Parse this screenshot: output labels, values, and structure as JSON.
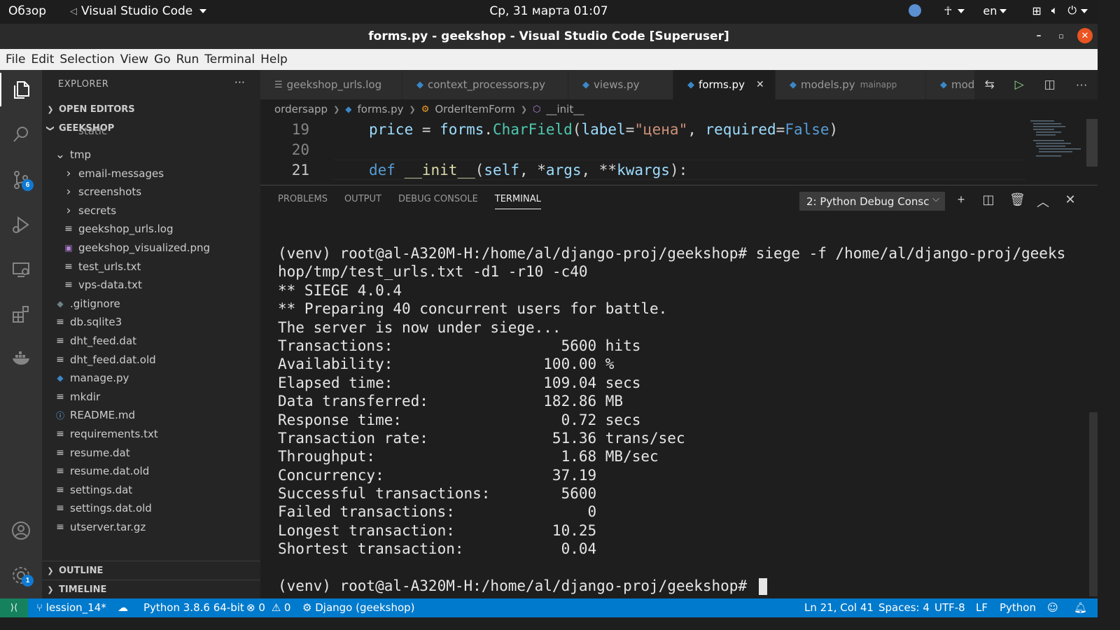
{
  "os_bar": {
    "activities": "Обзор",
    "app_name": "Visual Studio Code",
    "clock": "Ср, 31 марта  01:07",
    "lang": "en"
  },
  "window": {
    "title": "forms.py - geekshop - Visual Studio Code [Superuser]"
  },
  "menu": [
    "File",
    "Edit",
    "Selection",
    "View",
    "Go",
    "Run",
    "Terminal",
    "Help"
  ],
  "activity_bar": {
    "scm_badge": "6",
    "settings_badge": "1"
  },
  "explorer": {
    "title": "EXPLORER",
    "more": "···",
    "open_editors": "OPEN EDITORS",
    "project": "GEEKSHOP",
    "partial_top": "static",
    "items": [
      {
        "label": "tmp",
        "kind": "folder-open",
        "indent": 1
      },
      {
        "label": "email-messages",
        "kind": "folder",
        "indent": 2
      },
      {
        "label": "screenshots",
        "kind": "folder",
        "indent": 2
      },
      {
        "label": "secrets",
        "kind": "folder",
        "indent": 2
      },
      {
        "label": "geekshop_urls.log",
        "kind": "lines",
        "indent": 2
      },
      {
        "label": "geekshop_visualized.png",
        "kind": "img",
        "indent": 2
      },
      {
        "label": "test_urls.txt",
        "kind": "lines",
        "indent": 2
      },
      {
        "label": "vps-data.txt",
        "kind": "lines",
        "indent": 2
      },
      {
        "label": ".gitignore",
        "kind": "git",
        "indent": 1
      },
      {
        "label": "db.sqlite3",
        "kind": "lines",
        "indent": 1
      },
      {
        "label": "dht_feed.dat",
        "kind": "lines",
        "indent": 1
      },
      {
        "label": "dht_feed.dat.old",
        "kind": "lines",
        "indent": 1
      },
      {
        "label": "manage.py",
        "kind": "py",
        "indent": 1
      },
      {
        "label": "mkdir",
        "kind": "lines",
        "indent": 1
      },
      {
        "label": "README.md",
        "kind": "info",
        "indent": 1
      },
      {
        "label": "requirements.txt",
        "kind": "lines",
        "indent": 1
      },
      {
        "label": "resume.dat",
        "kind": "lines",
        "indent": 1
      },
      {
        "label": "resume.dat.old",
        "kind": "lines",
        "indent": 1
      },
      {
        "label": "settings.dat",
        "kind": "lines",
        "indent": 1
      },
      {
        "label": "settings.dat.old",
        "kind": "lines",
        "indent": 1
      },
      {
        "label": "utserver.tar.gz",
        "kind": "lines",
        "indent": 1
      }
    ],
    "outline": "OUTLINE",
    "timeline": "TIMELINE"
  },
  "tabs": [
    {
      "label": "geekshop_urls.log",
      "icon": "lines",
      "active": false
    },
    {
      "label": "context_processors.py",
      "icon": "py",
      "active": false
    },
    {
      "label": "views.py",
      "icon": "py",
      "active": false
    },
    {
      "label": "forms.py",
      "icon": "py",
      "active": true
    },
    {
      "label": "models.py",
      "sub": "mainapp",
      "icon": "py",
      "active": false
    },
    {
      "label": "mode",
      "icon": "py",
      "active": false
    }
  ],
  "breadcrumb": [
    "ordersapp",
    "forms.py",
    "OrderItemForm",
    "__init__"
  ],
  "editor": {
    "lines": [
      {
        "num": "19",
        "current": false
      },
      {
        "num": "20",
        "current": false
      },
      {
        "num": "21",
        "current": true
      }
    ]
  },
  "panel": {
    "tabs": [
      "PROBLEMS",
      "OUTPUT",
      "DEBUG CONSOLE",
      "TERMINAL"
    ],
    "active_tab": "TERMINAL",
    "terminal_select": "2: Python Debug Consc"
  },
  "terminal": {
    "lines": [
      "(venv) root@al-A320M-H:/home/al/django-proj/geekshop# siege -f /home/al/django-proj/geeks",
      "hop/tmp/test_urls.txt -d1 -r10 -c40",
      "** SIEGE 4.0.4",
      "** Preparing 40 concurrent users for battle.",
      "The server is now under siege...",
      "Transactions:                   5600 hits",
      "Availability:                 100.00 %",
      "Elapsed time:                 109.04 secs",
      "Data transferred:             182.86 MB",
      "Response time:                  0.72 secs",
      "Transaction rate:              51.36 trans/sec",
      "Throughput:                     1.68 MB/sec",
      "Concurrency:                   37.19",
      "Successful transactions:        5600",
      "Failed transactions:               0",
      "Longest transaction:           10.25",
      "Shortest transaction:           0.04",
      ""
    ],
    "prompt": "(venv) root@al-A320M-H:/home/al/django-proj/geekshop# "
  },
  "status": {
    "branch": "lession_14*",
    "python": "Python 3.8.6 64-bit",
    "errors": "0",
    "warnings": "0",
    "django": "Django (geekshop)",
    "position": "Ln 21, Col 41",
    "spaces": "Spaces: 4",
    "encoding": "UTF-8",
    "eol": "LF",
    "language": "Python"
  },
  "colors": {
    "status_bar": "#007acc",
    "activity_bar": "#333333",
    "sidebar": "#252526",
    "editor": "#1e1e1e",
    "ubuntu_close": "#e95420"
  }
}
